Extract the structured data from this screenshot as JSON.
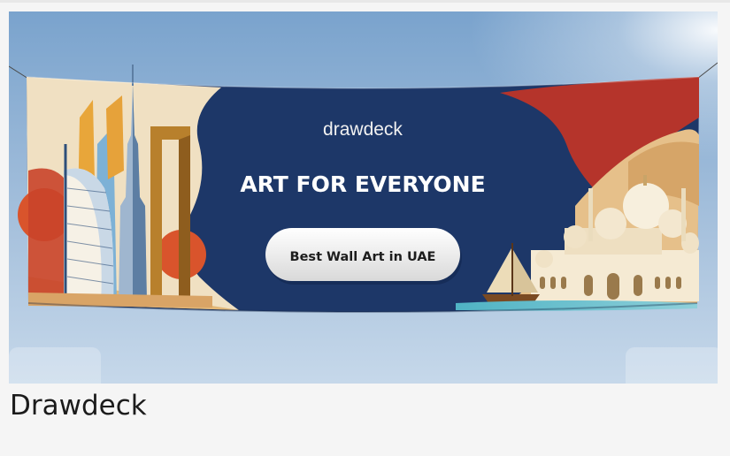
{
  "banner": {
    "brand": "drawdeck",
    "headline": "ART FOR EVERYONE",
    "cta_label": "Best Wall Art in UAE"
  },
  "caption": {
    "title": "Drawdeck"
  },
  "colors": {
    "banner_navy": "#1d3768",
    "sky_top": "#7ea6cf",
    "sky_bottom": "#c4d6e8",
    "accent_red": "#b7332a",
    "sand": "#e7c590",
    "cream": "#f1e3c6"
  }
}
